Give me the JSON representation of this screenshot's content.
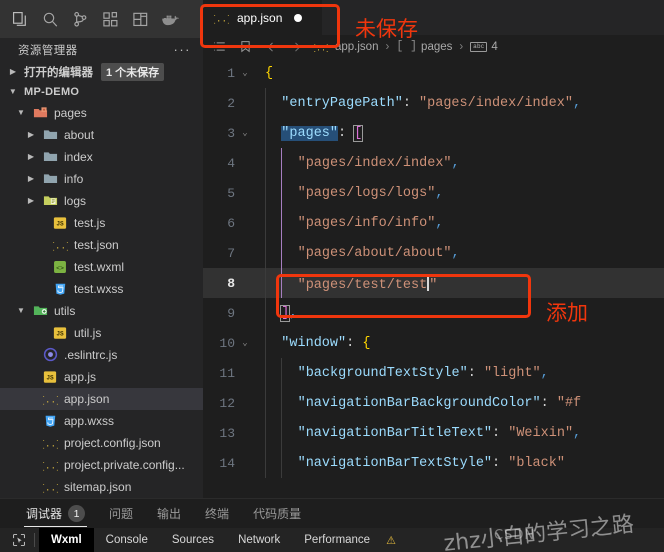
{
  "activity_bar": {
    "items": [
      {
        "name": "explorer-icon",
        "label": "资源管理器"
      },
      {
        "name": "search-icon",
        "label": "搜索"
      },
      {
        "name": "source-control-icon",
        "label": "源代码管理"
      },
      {
        "name": "extensions-icon",
        "label": "扩展"
      },
      {
        "name": "layout-icon",
        "label": "布局"
      },
      {
        "name": "docker-icon",
        "label": "Docker"
      }
    ]
  },
  "sidebar": {
    "title": "资源管理器",
    "more_label": "···",
    "open_editors": {
      "label": "打开的编辑器",
      "badge": "1 个未保存"
    },
    "project": {
      "label": "MP-DEMO"
    },
    "tree": [
      {
        "label": "pages",
        "icon": "folder-open-icon",
        "kind": "folder",
        "indent": 1,
        "expanded": true
      },
      {
        "label": "about",
        "icon": "folder-icon",
        "kind": "folder",
        "indent": 2,
        "expanded": false
      },
      {
        "label": "index",
        "icon": "folder-icon",
        "kind": "folder",
        "indent": 2,
        "expanded": false
      },
      {
        "label": "info",
        "icon": "folder-icon",
        "kind": "folder",
        "indent": 2,
        "expanded": false
      },
      {
        "label": "logs",
        "icon": "folder-logs-icon",
        "kind": "folder",
        "indent": 2,
        "expanded": false
      },
      {
        "label": "test.js",
        "icon": "js-icon",
        "kind": "file",
        "indent": 3
      },
      {
        "label": "test.json",
        "icon": "json-icon",
        "kind": "file",
        "indent": 3
      },
      {
        "label": "test.wxml",
        "icon": "wxml-icon",
        "kind": "file",
        "indent": 3
      },
      {
        "label": "test.wxss",
        "icon": "css-icon",
        "kind": "file",
        "indent": 3
      },
      {
        "label": "utils",
        "icon": "folder-utils-icon",
        "kind": "folder",
        "indent": 1,
        "expanded": true
      },
      {
        "label": "util.js",
        "icon": "js-icon",
        "kind": "file",
        "indent": 3
      },
      {
        "label": ".eslintrc.js",
        "icon": "eslint-icon",
        "kind": "file",
        "indent": 2
      },
      {
        "label": "app.js",
        "icon": "js-icon",
        "kind": "file",
        "indent": 2
      },
      {
        "label": "app.json",
        "icon": "json-icon",
        "kind": "file",
        "indent": 2,
        "selected": true
      },
      {
        "label": "app.wxss",
        "icon": "css-icon",
        "kind": "file",
        "indent": 2
      },
      {
        "label": "project.config.json",
        "icon": "json-icon",
        "kind": "file",
        "indent": 2
      },
      {
        "label": "project.private.config...",
        "icon": "json-icon",
        "kind": "file",
        "indent": 2
      },
      {
        "label": "sitemap.json",
        "icon": "json-icon",
        "kind": "file",
        "indent": 2
      }
    ]
  },
  "editor": {
    "tab": {
      "label": "app.json",
      "icon": "json-icon",
      "dirty": true
    },
    "breadcrumb": {
      "tools": [
        "list-icon",
        "bookmark-icon",
        "arrow-left-icon",
        "arrow-right-icon"
      ],
      "items": [
        {
          "icon": "json-icon",
          "label": "app.json"
        },
        {
          "icon": "array-icon",
          "label": "pages"
        },
        {
          "icon": "abc-icon",
          "label": "4"
        }
      ],
      "separator": "›"
    },
    "lines": [
      {
        "num": "1",
        "fold": "v",
        "segments": [
          {
            "t": "{",
            "c": "tok-brace"
          }
        ]
      },
      {
        "num": "2",
        "fold": "",
        "indent": 1,
        "segments": [
          {
            "t": "\"entryPagePath\"",
            "c": "tok-key"
          },
          {
            "t": ": ",
            "c": "tok-colon"
          },
          {
            "t": "\"pages/index/index\"",
            "c": "tok-str"
          },
          {
            "t": ",",
            "c": "tok-comma"
          }
        ]
      },
      {
        "num": "3",
        "fold": "v",
        "indent": 1,
        "segments": [
          {
            "t": "\"pages\"",
            "c": "tok-key sel-key"
          },
          {
            "t": ": ",
            "c": "tok-colon"
          },
          {
            "t": "[",
            "c": "tok-bracket br-match"
          }
        ]
      },
      {
        "num": "4",
        "fold": "",
        "indent": 2,
        "segments": [
          {
            "t": "\"pages/index/index\"",
            "c": "tok-str"
          },
          {
            "t": ",",
            "c": "tok-comma"
          }
        ]
      },
      {
        "num": "5",
        "fold": "",
        "indent": 2,
        "segments": [
          {
            "t": "\"pages/logs/logs\"",
            "c": "tok-str"
          },
          {
            "t": ",",
            "c": "tok-comma"
          }
        ]
      },
      {
        "num": "6",
        "fold": "",
        "indent": 2,
        "segments": [
          {
            "t": "\"pages/info/info\"",
            "c": "tok-str"
          },
          {
            "t": ",",
            "c": "tok-comma"
          }
        ]
      },
      {
        "num": "7",
        "fold": "",
        "indent": 2,
        "segments": [
          {
            "t": "\"pages/about/about\"",
            "c": "tok-str"
          },
          {
            "t": ",",
            "c": "tok-comma"
          }
        ]
      },
      {
        "num": "8",
        "fold": "",
        "indent": 2,
        "active": true,
        "caret_after": 1,
        "segments": [
          {
            "t": "\"pages/test/test",
            "c": "tok-str"
          },
          {
            "t": "\"",
            "c": "tok-str"
          }
        ]
      },
      {
        "num": "9",
        "fold": "",
        "indent": 1,
        "segments": [
          {
            "t": "]",
            "c": "tok-bracket br-match"
          },
          {
            "t": ",",
            "c": "tok-comma"
          }
        ]
      },
      {
        "num": "10",
        "fold": "v",
        "indent": 1,
        "segments": [
          {
            "t": "\"window\"",
            "c": "tok-key"
          },
          {
            "t": ": ",
            "c": "tok-colon"
          },
          {
            "t": "{",
            "c": "tok-brace"
          }
        ]
      },
      {
        "num": "11",
        "fold": "",
        "indent": 2,
        "segments": [
          {
            "t": "\"backgroundTextStyle\"",
            "c": "tok-key"
          },
          {
            "t": ": ",
            "c": "tok-colon"
          },
          {
            "t": "\"light\"",
            "c": "tok-str"
          },
          {
            "t": ",",
            "c": "tok-comma"
          }
        ]
      },
      {
        "num": "12",
        "fold": "",
        "indent": 2,
        "segments": [
          {
            "t": "\"navigationBarBackgroundColor\"",
            "c": "tok-key"
          },
          {
            "t": ": ",
            "c": "tok-colon"
          },
          {
            "t": "\"#f",
            "c": "tok-str"
          }
        ]
      },
      {
        "num": "13",
        "fold": "",
        "indent": 2,
        "segments": [
          {
            "t": "\"navigationBarTitleText\"",
            "c": "tok-key"
          },
          {
            "t": ": ",
            "c": "tok-colon"
          },
          {
            "t": "\"Weixin\"",
            "c": "tok-str"
          },
          {
            "t": ",",
            "c": "tok-comma"
          }
        ]
      },
      {
        "num": "14",
        "fold": "",
        "indent": 2,
        "segments": [
          {
            "t": "\"navigationBarTextStyle\"",
            "c": "tok-key"
          },
          {
            "t": ": ",
            "c": "tok-colon"
          },
          {
            "t": "\"black\"",
            "c": "tok-str"
          }
        ]
      }
    ]
  },
  "panel": {
    "tabs": [
      {
        "label": "调试器",
        "count": "1",
        "active": true
      },
      {
        "label": "问题",
        "active": false
      },
      {
        "label": "输出",
        "active": false
      },
      {
        "label": "终端",
        "active": false
      },
      {
        "label": "代码质量",
        "active": false
      }
    ]
  },
  "devtools": {
    "inspect_icon": "inspect-element-icon",
    "tabs": [
      {
        "label": "Wxml",
        "active": true
      },
      {
        "label": "Console",
        "active": false
      },
      {
        "label": "Sources",
        "active": false
      },
      {
        "label": "Network",
        "active": false
      },
      {
        "label": "Performance",
        "active": false
      }
    ],
    "warning_icon": "warning-icon"
  },
  "annotations": {
    "color": "#f0360d",
    "unsaved_label": "未保存",
    "add_label": "添加"
  },
  "watermark": {
    "text": "zhz小白的学习之路",
    "overlay": "CSDN"
  }
}
